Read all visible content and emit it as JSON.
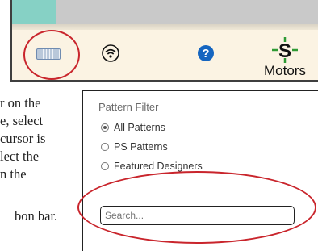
{
  "toolbar": {
    "tools": [
      {
        "icon": "keyboard-icon"
      },
      {
        "icon": "wifi-icon"
      },
      {
        "icon": "help-icon"
      },
      {
        "icon": "motors-icon",
        "label": "Motors"
      }
    ],
    "accent": "#86d1c5",
    "highlight_color": "#c9252c"
  },
  "instructions": {
    "lines": [
      "r on the",
      "e, select",
      "cursor is",
      "lect the",
      "n the",
      "bon bar."
    ]
  },
  "filter": {
    "title": "Pattern Filter",
    "options": [
      {
        "label": "All Patterns",
        "selected": true
      },
      {
        "label": "PS Patterns",
        "selected": false
      },
      {
        "label": "Featured Designers",
        "selected": false
      }
    ],
    "search_placeholder": "Search..."
  }
}
